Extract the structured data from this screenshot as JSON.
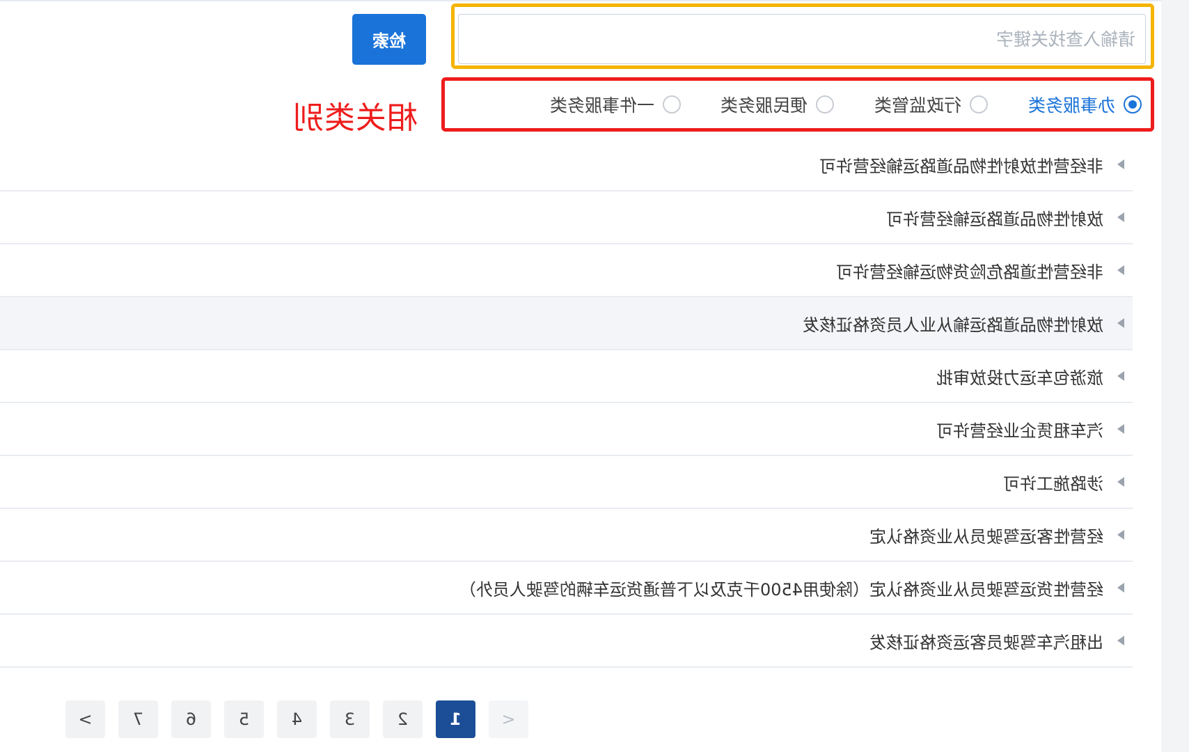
{
  "search": {
    "placeholder": "请输入查找关键字",
    "button_label": "检索"
  },
  "categories": {
    "annotation": "相关类别",
    "options": [
      {
        "label": "办事服务类",
        "selected": true
      },
      {
        "label": "行政监管类",
        "selected": false
      },
      {
        "label": "便民服务类",
        "selected": false
      },
      {
        "label": "一件事服务类",
        "selected": false
      }
    ]
  },
  "items": [
    "非经营性放射性物品道路运输经营许可",
    "放射性物品道路运输经营许可",
    "非经营性道路危险货物运输经营许可",
    "放射性物品道路运输从业人员资格证核发",
    "旅游包车运力投放审批",
    "汽车租赁企业经营许可",
    "涉路施工许可",
    "经营性客运驾驶员从业资格认定",
    "经营性货运驾驶员从业资格认定（除使用4500千克及以下普通货运车辆的驾驶人员外）",
    "出租汽车驾驶员客运资格证核发"
  ],
  "highlighted_item_index": 3,
  "pagination": {
    "prev": "<",
    "pages": [
      "1",
      "2",
      "3",
      "4",
      "5",
      "6",
      "7"
    ],
    "current": "1",
    "next": ">"
  },
  "colors": {
    "accent": "#1a73d8",
    "search_box_outline": "#f5b400",
    "category_box_outline": "#ee1c1c",
    "annotation_text": "#ee1c1c",
    "active_page": "#1b4e96"
  },
  "icons": {
    "list_item": "caret-right-icon",
    "radio": "radio-circle-icon"
  }
}
